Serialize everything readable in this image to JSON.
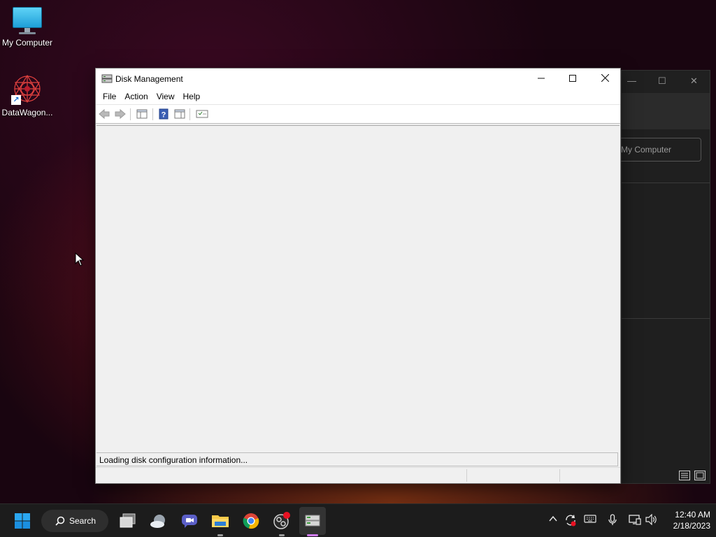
{
  "desktop": {
    "icons": [
      {
        "label": "My Computer",
        "icon": "monitor-icon"
      },
      {
        "label": "DataWagon...",
        "icon": "datawagon-icon"
      }
    ]
  },
  "background_window": {
    "field_text": "My Computer"
  },
  "window": {
    "title": "Disk Management",
    "icon": "disk-management-icon",
    "controls": [
      "minimize",
      "maximize",
      "close"
    ],
    "menu": [
      "File",
      "Action",
      "View",
      "Help"
    ],
    "toolbar": [
      "back-icon",
      "forward-icon",
      "show-hide-console-tree-icon",
      "help-icon",
      "show-hide-action-pane-icon",
      "properties-icon"
    ],
    "status_message": "Loading disk configuration information..."
  },
  "taskbar": {
    "search_label": "Search",
    "apps": [
      "start-icon",
      "search-icon",
      "task-view-icon",
      "widgets-icon",
      "chat-icon",
      "file-explorer-icon",
      "chrome-icon",
      "obs-icon",
      "disk-management-taskbar-icon"
    ],
    "tray": [
      "chevron-up-icon",
      "sync-icon",
      "keyboard-icon",
      "microphone-icon",
      "network-icon",
      "volume-icon"
    ],
    "time": "12:40 AM",
    "date": "2/18/2023"
  },
  "colors": {
    "accent": "#0078d4",
    "taskbar_bg": "#1c1c1c",
    "window_bg": "#f0f0f0",
    "notification_dot": "#e81123"
  }
}
